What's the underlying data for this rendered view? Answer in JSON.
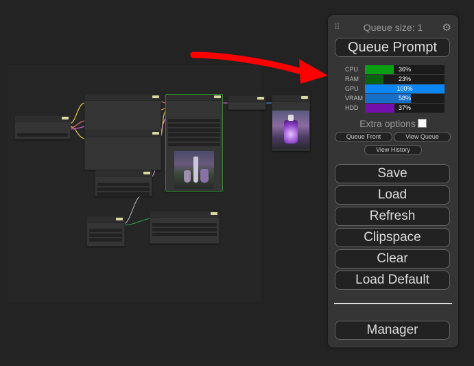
{
  "menu": {
    "queue_size_label": "Queue size: 1",
    "queue_prompt_label": "Queue Prompt",
    "stats": [
      {
        "name": "CPU",
        "percent": 36,
        "label": "36%",
        "color": "#0a9f14"
      },
      {
        "name": "RAM",
        "percent": 23,
        "label": "23%",
        "color": "#07630d"
      },
      {
        "name": "GPU",
        "percent": 100,
        "label": "100%",
        "color": "#0c86f3"
      },
      {
        "name": "VRAM",
        "percent": 58,
        "label": "58%",
        "color": "#176ec7"
      },
      {
        "name": "HDD",
        "percent": 37,
        "label": "37%",
        "color": "#730fab"
      }
    ],
    "extra_options_label": "Extra options",
    "queue_front_label": "Queue Front",
    "view_queue_label": "View Queue",
    "view_history_label": "View History",
    "save_label": "Save",
    "load_label": "Load",
    "refresh_label": "Refresh",
    "clipspace_label": "Clipspace",
    "clear_label": "Clear",
    "load_default_label": "Load Default",
    "manager_label": "Manager"
  },
  "icons": {
    "drag_handle": "drag-handle-icon",
    "settings": "gear-icon",
    "annotation_arrow": "red-arrow"
  },
  "colors": {
    "panel_bg": "#353535",
    "canvas_bg": "#232323",
    "arrow": "#ff0000"
  }
}
